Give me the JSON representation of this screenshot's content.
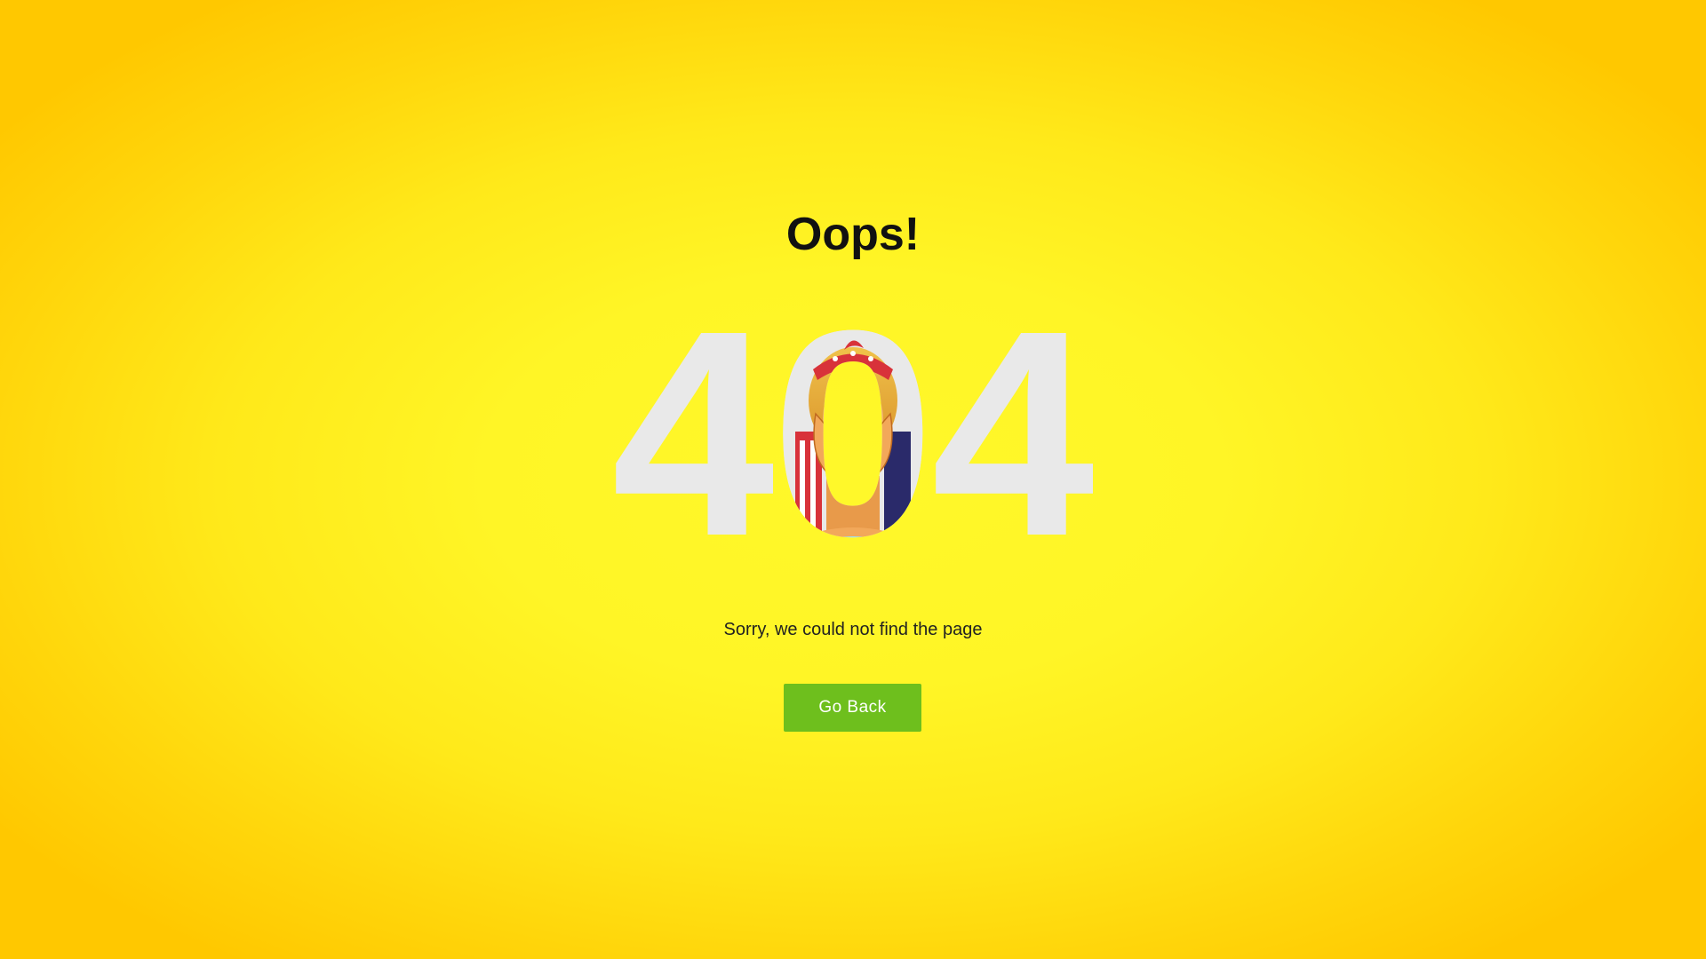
{
  "heading": "Oops!",
  "error_code": {
    "first_digit": "4",
    "middle_digit": "0",
    "last_digit": "4"
  },
  "illustration": {
    "icon": "surprised-woman-illustration"
  },
  "message": "Sorry, we could not find the page",
  "back_button": {
    "label": "Go Back"
  },
  "colors": {
    "background_center": "#fff82a",
    "background_edge": "#ffc800",
    "digits": "#e9e9e9",
    "button": "#6ebf1d",
    "button_text": "#ffffff",
    "heading": "#111111"
  }
}
